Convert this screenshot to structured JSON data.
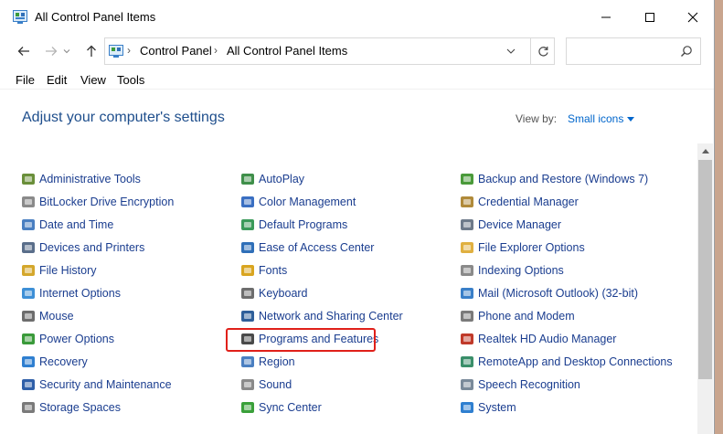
{
  "window": {
    "title": "All Control Panel Items"
  },
  "address": {
    "crumbs": [
      "Control Panel",
      "All Control Panel Items"
    ],
    "search_placeholder": ""
  },
  "menu": {
    "file": "File",
    "edit": "Edit",
    "view": "View",
    "tools": "Tools"
  },
  "header": {
    "title": "Adjust your computer's settings",
    "view_by_label": "View by:",
    "view_by_value": "Small icons"
  },
  "columns": [
    [
      {
        "label": "Administrative Tools",
        "icon": "administrative-tools-icon",
        "color": "#6a8f3a"
      },
      {
        "label": "BitLocker Drive Encryption",
        "icon": "bitlocker-icon",
        "color": "#8a8a8a"
      },
      {
        "label": "Date and Time",
        "icon": "clock-icon",
        "color": "#4a7fc1"
      },
      {
        "label": "Devices and Printers",
        "icon": "printer-icon",
        "color": "#5a6e8a"
      },
      {
        "label": "File History",
        "icon": "file-history-icon",
        "color": "#d4a72c"
      },
      {
        "label": "Internet Options",
        "icon": "globe-icon",
        "color": "#3d8fd6"
      },
      {
        "label": "Mouse",
        "icon": "mouse-icon",
        "color": "#6d6d6d"
      },
      {
        "label": "Power Options",
        "icon": "power-icon",
        "color": "#3a9a3a"
      },
      {
        "label": "Recovery",
        "icon": "recovery-icon",
        "color": "#2f7fd0"
      },
      {
        "label": "Security and Maintenance",
        "icon": "flag-icon",
        "color": "#2f5fa8"
      },
      {
        "label": "Storage Spaces",
        "icon": "storage-icon",
        "color": "#7a7a7a"
      }
    ],
    [
      {
        "label": "AutoPlay",
        "icon": "autoplay-icon",
        "color": "#3f8f4a"
      },
      {
        "label": "Color Management",
        "icon": "monitor-color-icon",
        "color": "#3a6fc2"
      },
      {
        "label": "Default Programs",
        "icon": "default-programs-icon",
        "color": "#3a9a5a"
      },
      {
        "label": "Ease of Access Center",
        "icon": "ease-of-access-icon",
        "color": "#2f6fb8"
      },
      {
        "label": "Fonts",
        "icon": "fonts-icon",
        "color": "#d9a520"
      },
      {
        "label": "Keyboard",
        "icon": "keyboard-icon",
        "color": "#6d6d6d"
      },
      {
        "label": "Network and Sharing Center",
        "icon": "network-icon",
        "color": "#2f5f9a"
      },
      {
        "label": "Programs and Features",
        "icon": "programs-features-icon",
        "color": "#4a4a4a"
      },
      {
        "label": "Region",
        "icon": "region-icon",
        "color": "#4a7fc1"
      },
      {
        "label": "Sound",
        "icon": "sound-icon",
        "color": "#8a8a8a"
      },
      {
        "label": "Sync Center",
        "icon": "sync-icon",
        "color": "#3aa03a"
      }
    ],
    [
      {
        "label": "Backup and Restore (Windows 7)",
        "icon": "backup-icon",
        "color": "#4a9a3a"
      },
      {
        "label": "Credential Manager",
        "icon": "credential-icon",
        "color": "#b08a3a"
      },
      {
        "label": "Device Manager",
        "icon": "device-manager-icon",
        "color": "#6d7a8a"
      },
      {
        "label": "File Explorer Options",
        "icon": "folder-options-icon",
        "color": "#e0b040"
      },
      {
        "label": "Indexing Options",
        "icon": "indexing-icon",
        "color": "#8a8a8a"
      },
      {
        "label": "Mail (Microsoft Outlook) (32-bit)",
        "icon": "mail-icon",
        "color": "#3a7fc8"
      },
      {
        "label": "Phone and Modem",
        "icon": "phone-icon",
        "color": "#7a7a7a"
      },
      {
        "label": "Realtek HD Audio Manager",
        "icon": "audio-manager-icon",
        "color": "#c03a2a"
      },
      {
        "label": "RemoteApp and Desktop Connections",
        "icon": "remoteapp-icon",
        "color": "#3a8f6a"
      },
      {
        "label": "Speech Recognition",
        "icon": "microphone-icon",
        "color": "#7a8a9a"
      },
      {
        "label": "System",
        "icon": "system-icon",
        "color": "#2f7fd0"
      }
    ]
  ],
  "colors": {
    "accent": "#1e4e8c",
    "link": "#1a3d8f",
    "highlight": "#e0201a"
  }
}
